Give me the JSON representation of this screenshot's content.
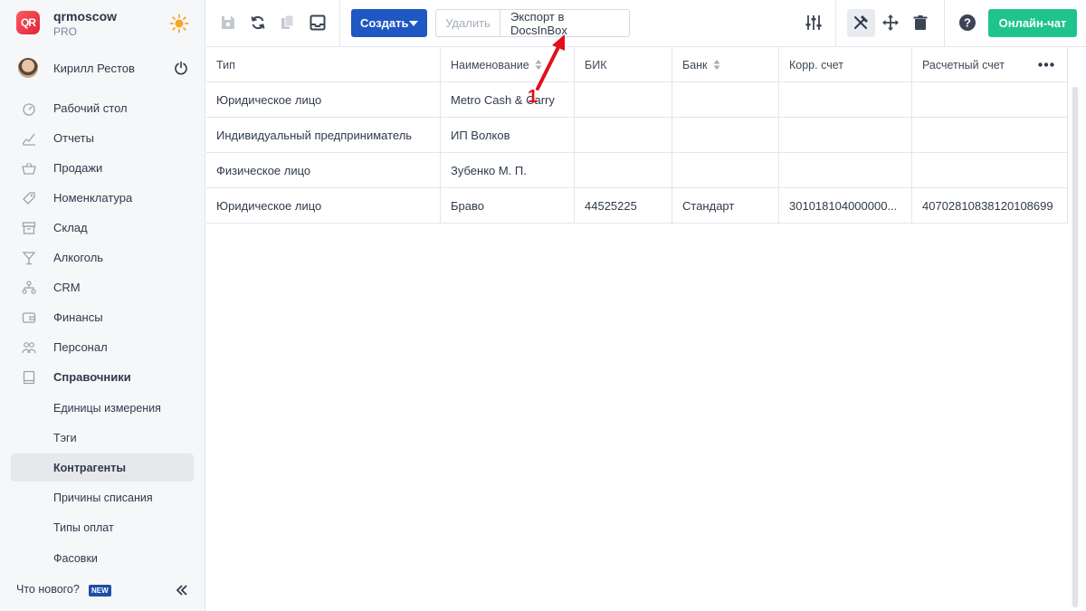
{
  "brand": {
    "name": "qrmoscow",
    "plan": "PRO",
    "logo_text": "QR"
  },
  "user": {
    "name": "Кирилл Рестов"
  },
  "nav": {
    "items": [
      {
        "label": "Рабочий стол",
        "icon": "dashboard-icon"
      },
      {
        "label": "Отчеты",
        "icon": "chart-icon"
      },
      {
        "label": "Продажи",
        "icon": "basket-icon"
      },
      {
        "label": "Номенклатура",
        "icon": "tag-icon"
      },
      {
        "label": "Склад",
        "icon": "box-icon"
      },
      {
        "label": "Алкоголь",
        "icon": "glass-icon"
      },
      {
        "label": "CRM",
        "icon": "crm-icon"
      },
      {
        "label": "Финансы",
        "icon": "wallet-icon"
      },
      {
        "label": "Персонал",
        "icon": "people-icon"
      },
      {
        "label": "Справочники",
        "icon": "book-icon"
      }
    ],
    "subitems": [
      {
        "label": "Единицы измерения"
      },
      {
        "label": "Тэги"
      },
      {
        "label": "Контрагенты"
      },
      {
        "label": "Причины списания"
      },
      {
        "label": "Типы оплат"
      },
      {
        "label": "Фасовки"
      }
    ],
    "whats_new": "Что нового?",
    "new_badge": "NEW"
  },
  "toolbar": {
    "create_label": "Создать",
    "delete_label": "Удалить",
    "export_label": "Экспорт в DocsInBox",
    "chat_label": "Онлайн-чат"
  },
  "table": {
    "columns": [
      "Тип",
      "Наименование",
      "БИК",
      "Банк",
      "Корр. счет",
      "Расчетный счет"
    ],
    "rows": [
      [
        "Юридическое лицо",
        "Metro Cash & Carry",
        "",
        "",
        "",
        ""
      ],
      [
        "Индивидуальный предприниматель",
        "ИП Волков",
        "",
        "",
        "",
        ""
      ],
      [
        "Физическое лицо",
        "Зубенко М. П.",
        "",
        "",
        "",
        ""
      ],
      [
        "Юридическое лицо",
        "Браво",
        "44525225",
        "Стандарт",
        "301018104000000...",
        "40702810838120108699"
      ]
    ]
  },
  "annotation": {
    "label": "1",
    "color": "#e0101a"
  },
  "colors": {
    "primary": "#1f57c3",
    "success": "#1fc48d",
    "sidebar_bg": "#f6f7f9"
  }
}
